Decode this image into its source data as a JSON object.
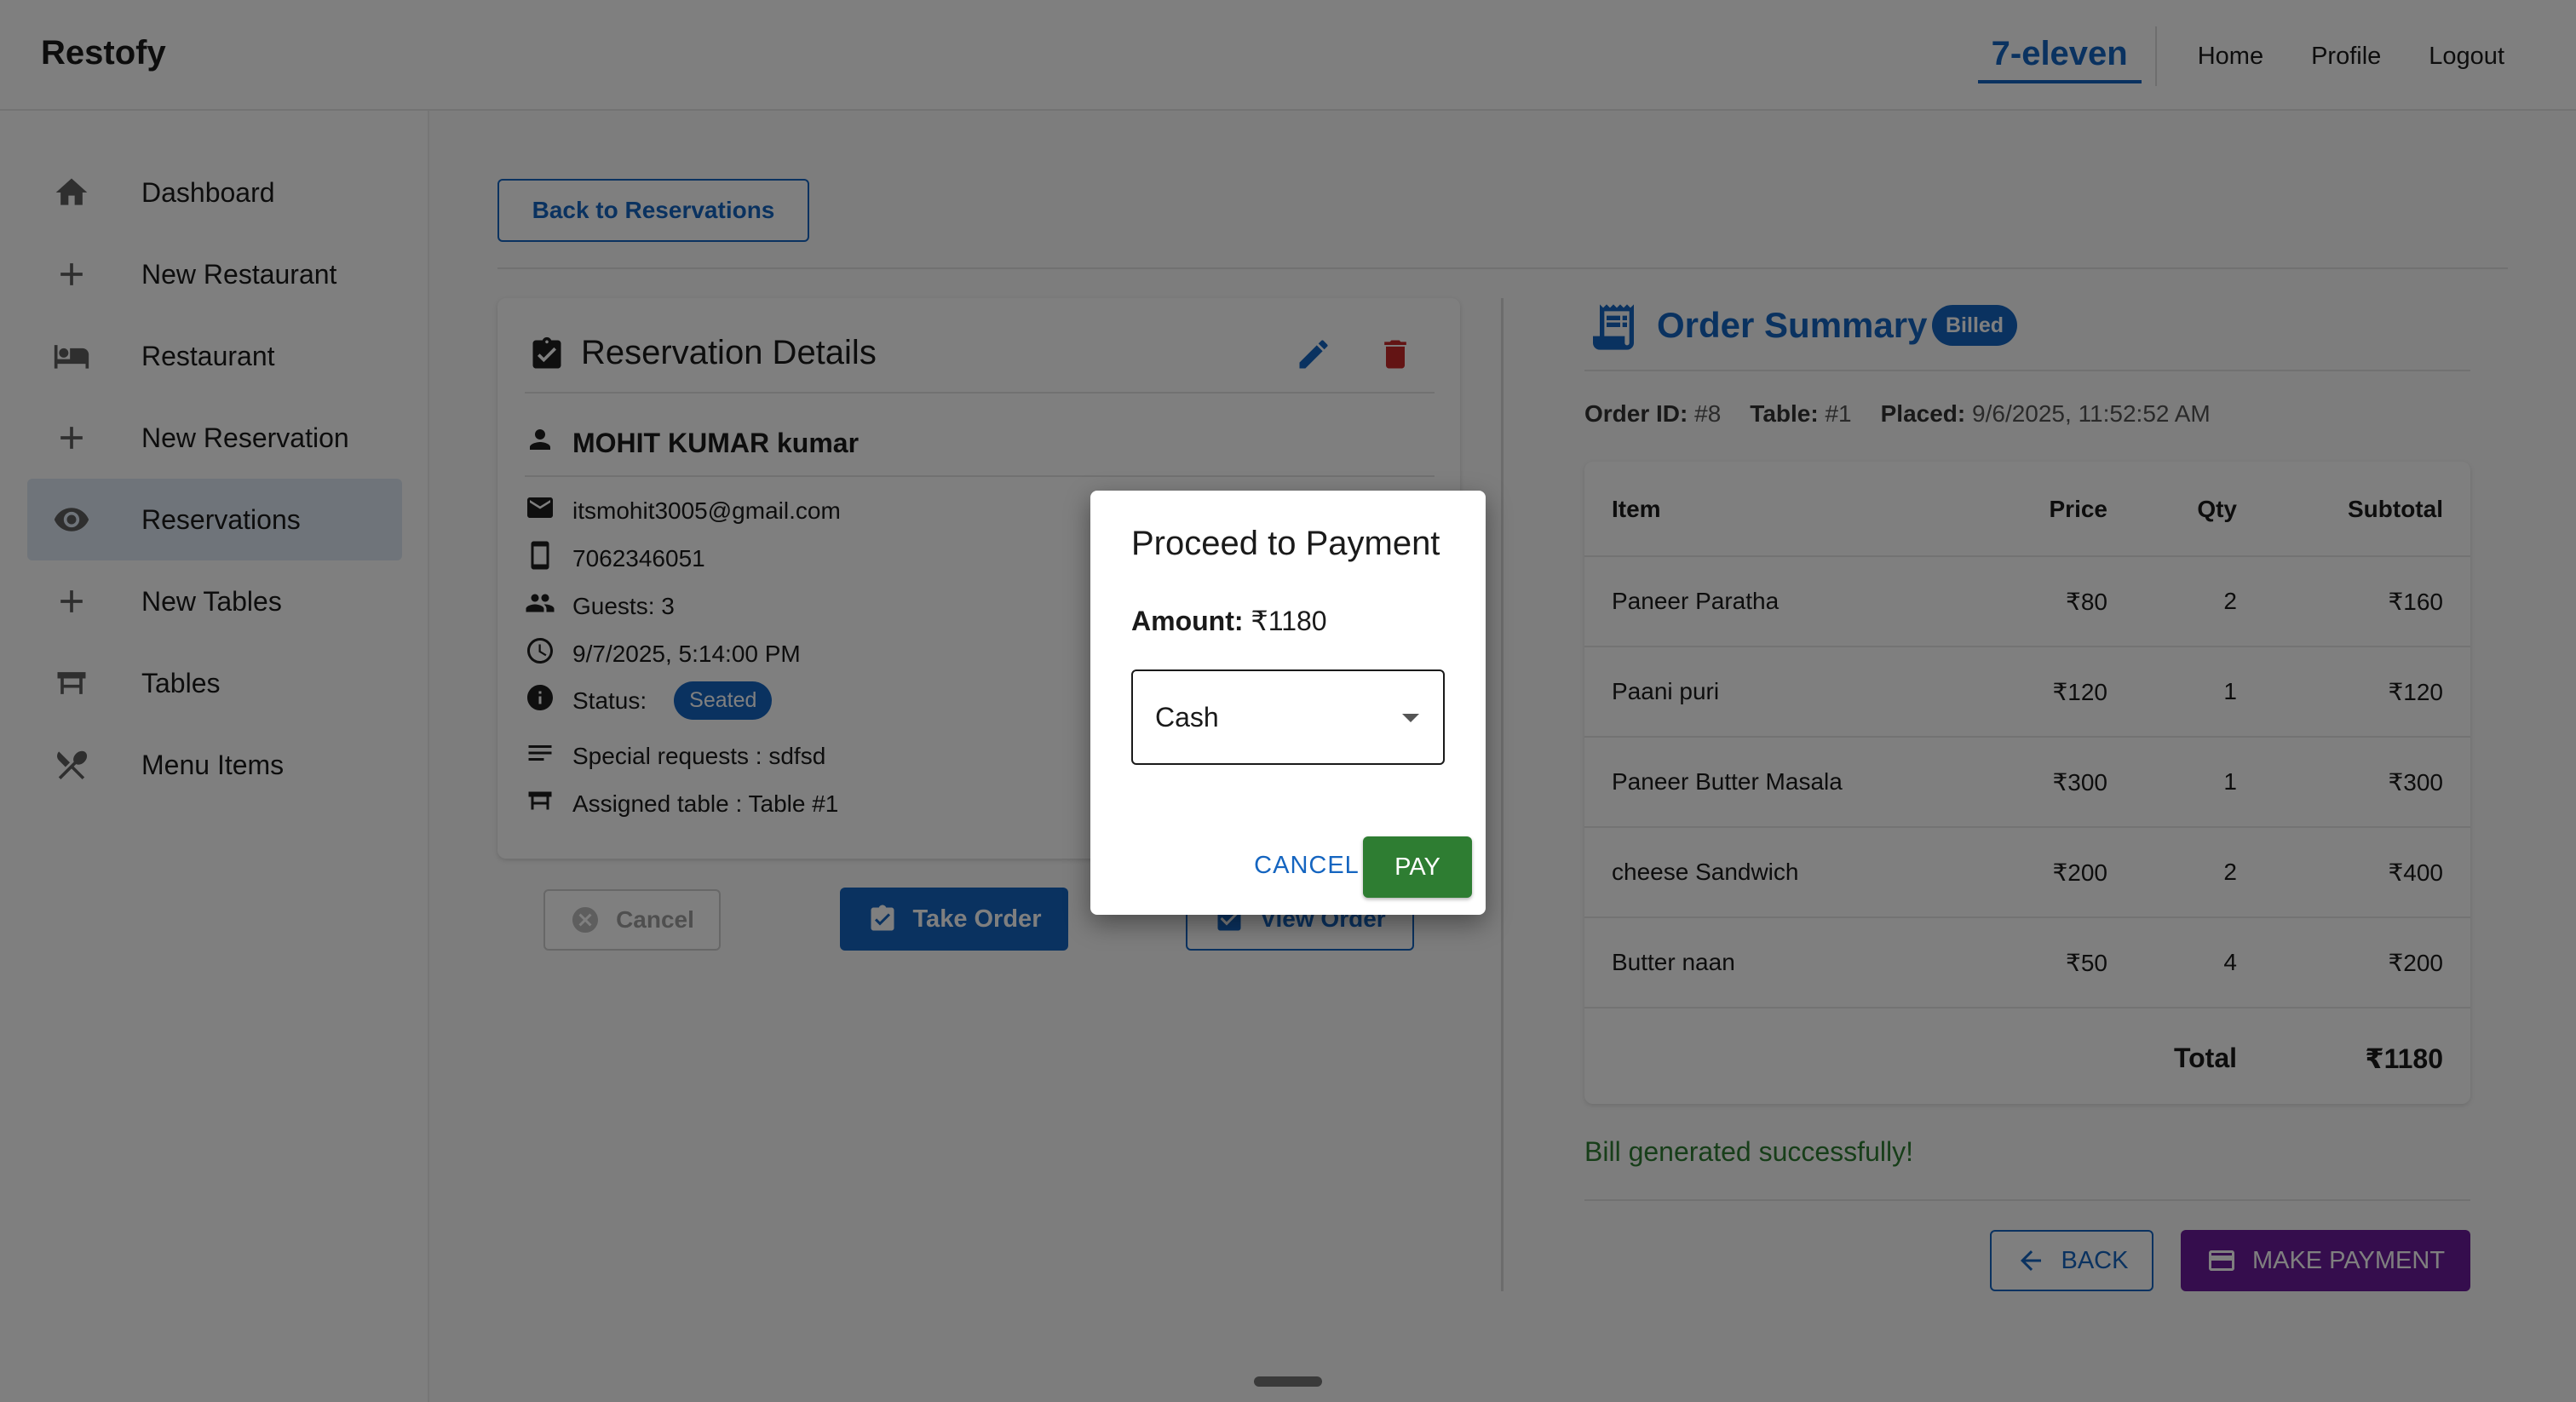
{
  "app": {
    "brand": "Restofy"
  },
  "topnav": {
    "restaurant": "7-eleven",
    "home": "Home",
    "profile": "Profile",
    "logout": "Logout"
  },
  "sidebar": {
    "items": [
      {
        "label": "Dashboard",
        "icon": "home-icon"
      },
      {
        "label": "New Restaurant",
        "icon": "plus-icon"
      },
      {
        "label": "Restaurant",
        "icon": "bed-icon"
      },
      {
        "label": "New Reservation",
        "icon": "plus-icon"
      },
      {
        "label": "Reservations",
        "icon": "eye-icon",
        "active": true
      },
      {
        "label": "New Tables",
        "icon": "plus-icon"
      },
      {
        "label": "Tables",
        "icon": "table-icon"
      },
      {
        "label": "Menu Items",
        "icon": "utensils-icon"
      }
    ]
  },
  "reservation": {
    "back_label": "Back to Reservations",
    "title": "Reservation Details",
    "name": "MOHIT KUMAR kumar",
    "email": "itsmohit3005@gmail.com",
    "phone": "7062346051",
    "guests": "Guests: 3",
    "datetime": "9/7/2025, 5:14:00 PM",
    "status_label": "Status:",
    "status": "Seated",
    "special": "Special requests : sdfsd",
    "assigned": "Assigned table : Table #1",
    "cancel_label": "Cancel",
    "take_order_label": "Take Order",
    "view_order_label": "View Order"
  },
  "order": {
    "title": "Order Summary",
    "badge": "Billed",
    "id_label": "Order ID:",
    "id_value": "#8",
    "table_label": "Table:",
    "table_value": "#1",
    "placed_label": "Placed:",
    "placed_value": "9/6/2025, 11:52:52 AM",
    "columns": [
      "Item",
      "Price",
      "Qty",
      "Subtotal"
    ],
    "rows": [
      {
        "item": "Paneer Paratha",
        "price": "₹80",
        "qty": "2",
        "subtotal": "₹160"
      },
      {
        "item": "Paani puri",
        "price": "₹120",
        "qty": "1",
        "subtotal": "₹120"
      },
      {
        "item": "Paneer Butter Masala",
        "price": "₹300",
        "qty": "1",
        "subtotal": "₹300"
      },
      {
        "item": "cheese Sandwich",
        "price": "₹200",
        "qty": "2",
        "subtotal": "₹400"
      },
      {
        "item": "Butter naan",
        "price": "₹50",
        "qty": "4",
        "subtotal": "₹200"
      }
    ],
    "total_label": "Total",
    "total_value": "₹1180",
    "bill_message": "Bill generated successfully!",
    "back_label": "BACK",
    "pay_label": "MAKE PAYMENT"
  },
  "dialog": {
    "title": "Proceed to Payment",
    "amount_label": "Amount:",
    "amount_value": "₹1180",
    "method": "Cash",
    "cancel_label": "CANCEL",
    "pay_label": "PAY"
  },
  "colors": {
    "primary": "#1565c0",
    "success": "#2e7d32",
    "danger": "#c62828",
    "purple": "#6a1b9a"
  }
}
